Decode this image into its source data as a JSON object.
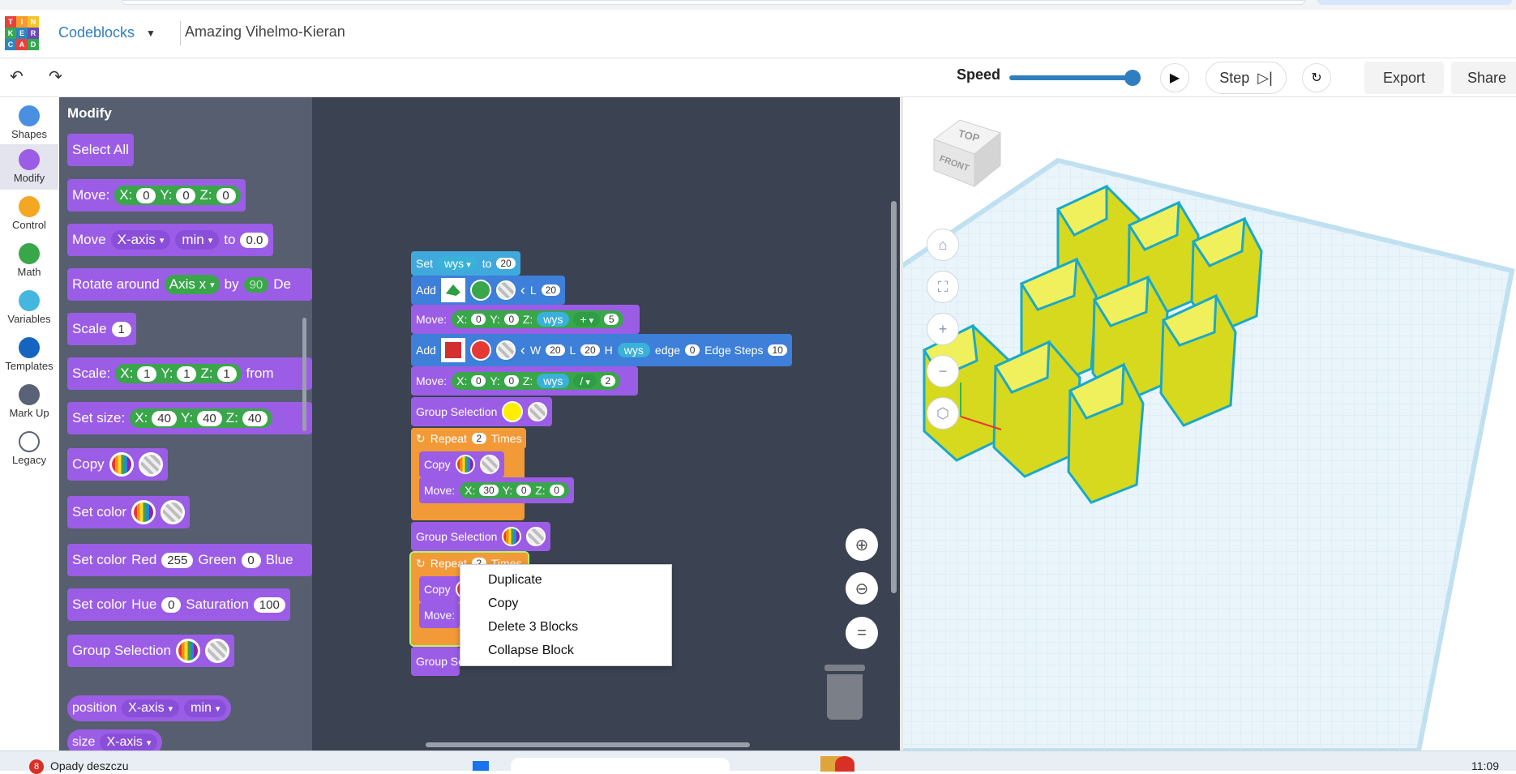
{
  "app": {
    "logo_letters": [
      "T",
      "I",
      "N",
      "K",
      "E",
      "R",
      "C",
      "A",
      "D"
    ],
    "mode": "Codeblocks",
    "design_name": "Amazing Vihelmo-Kieran"
  },
  "toolbar": {
    "speed_label": "Speed",
    "speed_value": 0.95,
    "step_label": "Step",
    "export_label": "Export",
    "share_label": "Share"
  },
  "categories": [
    {
      "label": "Shapes",
      "color": "#4a90e2"
    },
    {
      "label": "Modify",
      "color": "#9b5de5"
    },
    {
      "label": "Control",
      "color": "#f5a623"
    },
    {
      "label": "Math",
      "color": "#3aa64a"
    },
    {
      "label": "Variables",
      "color": "#45b6e0"
    },
    {
      "label": "Templates",
      "color": "#1565c0"
    },
    {
      "label": "Mark Up",
      "color": "#5a6275"
    },
    {
      "label": "Legacy",
      "color": "#ffffff"
    }
  ],
  "flyout": {
    "title": "Modify",
    "select_all": "Select All",
    "move": {
      "label": "Move:",
      "x_label": "X:",
      "x": "0",
      "y_label": "Y:",
      "y": "0",
      "z_label": "Z:",
      "z": "0"
    },
    "move_axis": {
      "label": "Move",
      "axis": "X-axis",
      "mode": "min",
      "to": "to",
      "value": "0.0"
    },
    "rotate": {
      "label": "Rotate around",
      "axis": "Axis x",
      "by": "by",
      "value": "90",
      "suffix": "De"
    },
    "scale": {
      "label": "Scale",
      "value": "1"
    },
    "scale_xyz": {
      "label": "Scale:",
      "x_label": "X:",
      "x": "1",
      "y_label": "Y:",
      "y": "1",
      "z_label": "Z:",
      "z": "1",
      "suffix": "from"
    },
    "set_size": {
      "label": "Set size:",
      "x_label": "X:",
      "x": "40",
      "y_label": "Y:",
      "y": "40",
      "z_label": "Z:",
      "z": "40"
    },
    "copy": "Copy",
    "set_color": "Set color",
    "set_color_rgb": {
      "label": "Set color",
      "red_label": "Red",
      "red": "255",
      "green_label": "Green",
      "green": "0",
      "blue_label": "Blue"
    },
    "set_color_hsv": {
      "label": "Set color",
      "hue_label": "Hue",
      "hue": "0",
      "sat_label": "Saturation",
      "sat": "100"
    },
    "group_selection": "Group Selection",
    "position": {
      "label": "position",
      "axis": "X-axis",
      "mode": "min"
    },
    "size": {
      "label": "size",
      "axis": "X-axis"
    }
  },
  "workspace": {
    "set": {
      "label": "Set",
      "var": "wys",
      "to": "to",
      "value": "20"
    },
    "add1": {
      "label": "Add",
      "l_label": "L",
      "l": "20"
    },
    "move1": {
      "label": "Move:",
      "x_label": "X:",
      "x": "0",
      "y_label": "Y:",
      "y": "0",
      "z_label": "Z:",
      "var": "wys",
      "op": "+",
      "operand": "5"
    },
    "add2": {
      "label": "Add",
      "w_label": "W",
      "w": "20",
      "l_label": "L",
      "l": "20",
      "h_label": "H",
      "var": "wys",
      "edge_label": "edge",
      "edge": "0",
      "steps_label": "Edge Steps",
      "steps": "10"
    },
    "move2": {
      "label": "Move:",
      "x_label": "X:",
      "x": "0",
      "y_label": "Y:",
      "y": "0",
      "z_label": "Z:",
      "var": "wys",
      "op": "/",
      "operand": "2"
    },
    "group1": "Group Selection",
    "repeat1": {
      "label": "Repeat",
      "times": "2",
      "suffix": "Times"
    },
    "copy1": "Copy",
    "move3": {
      "label": "Move:",
      "x_label": "X:",
      "x": "30",
      "y_label": "Y:",
      "y": "0",
      "z_label": "Z:",
      "z": "0"
    },
    "group2": "Group Selection",
    "repeat2": {
      "label": "Repeat",
      "times": "2",
      "suffix": "Times"
    },
    "copy2": "Copy",
    "move4": "Move:",
    "group3": "Group Se"
  },
  "context_menu": [
    "Duplicate",
    "Copy",
    "Delete 3 Blocks",
    "Collapse Block"
  ],
  "viewcube": {
    "top": "TOP",
    "front": "FRONT"
  },
  "taskbar": {
    "badge": "8",
    "weather": "Opady deszczu",
    "time": "11:09"
  }
}
